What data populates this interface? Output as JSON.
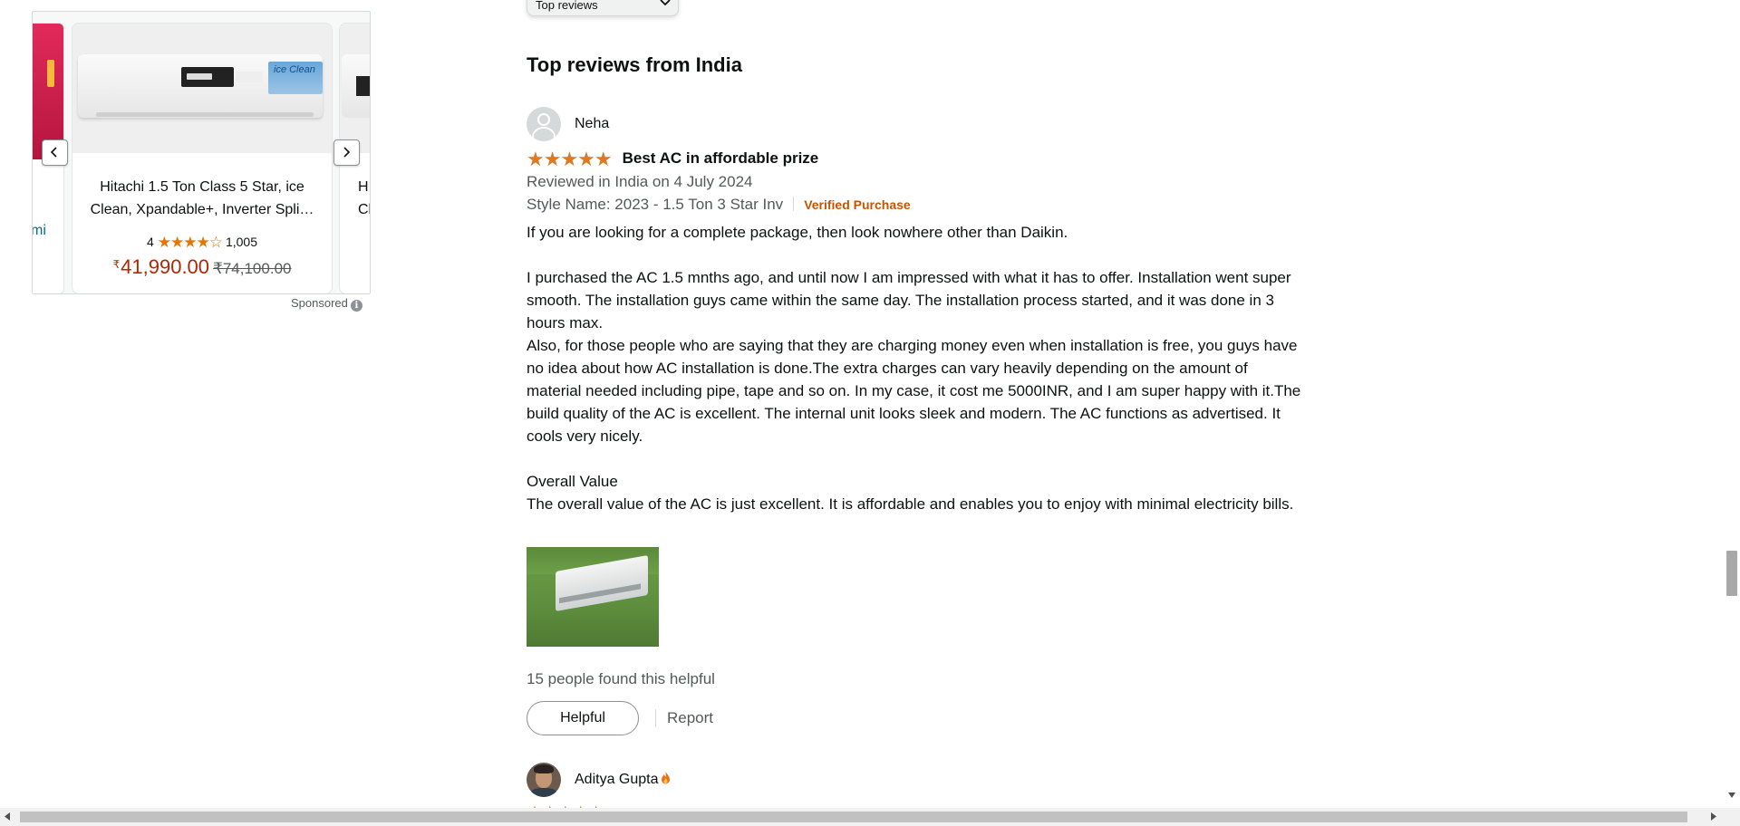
{
  "sponsored_ad": {
    "prev_fragment": "mi",
    "product_title": "Hitachi 1.5 Ton Class 5 Star, ice Clean, Xpandable+, Inverter Spli…",
    "rating_value": "4",
    "rating_count": "1,005",
    "currency_symbol": "₹",
    "price": "41,990.00",
    "old_price": "₹74,100.00",
    "image_badge": "ice Clean",
    "next_fragment_line1": "H",
    "next_fragment_line2": "Cle",
    "sponsored_label": "Sponsored",
    "info_icon": "i"
  },
  "sort": {
    "selected": "Top reviews"
  },
  "section_title": "Top reviews from India",
  "review": {
    "reviewer": "Neha",
    "stars": "★★★★★",
    "title": "Best AC in affordable prize",
    "date": "Reviewed in India on 4 July 2024",
    "style": "Style Name: 2023 - 1.5 Ton 3 Star Inv",
    "verified": "Verified Purchase",
    "body": {
      "p1": "If you are looking for a complete package, then look nowhere other than Daikin.",
      "p2a": "I purchased the AC 1.5 mnths ago, and until now I am impressed with what it has to offer. Installation went super smooth. The installation guys came within the same day. The installation process started, and it was done in 3 hours max.",
      "p2b": "Also, for those people who are saying that they are charging money even when installation is free, you guys have no idea about how AC installation is done.The extra charges can vary heavily depending on the amount of material needed including pipe, tape and so on. In my case, it cost me 5000INR, and I am super happy with it.The build quality of the AC is excellent. The internal unit looks sleek and modern. The AC functions as advertised. It cools very nicely.",
      "p3a": "Overall Value",
      "p3b": "The overall value of the AC is just excellent. It is affordable and enables you to enjoy with minimal electricity bills."
    },
    "helpful_count": "15 people found this helpful",
    "helpful_button": "Helpful",
    "report_link": "Report"
  },
  "next_review": {
    "reviewer": "Aditya Gupta",
    "stars": "★★★★★"
  },
  "colors": {
    "star": "#de7921",
    "price": "#b12704",
    "verified": "#c45500",
    "link": "#007185"
  }
}
